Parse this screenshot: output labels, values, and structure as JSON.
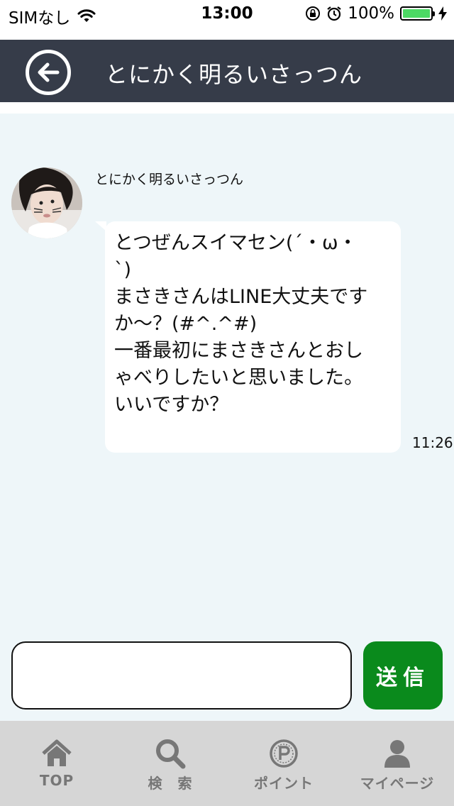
{
  "status_bar": {
    "carrier": "SIMなし",
    "time": "13:00",
    "battery_percent": "100%",
    "battery_level": 1.0,
    "battery_color": "#4cd964"
  },
  "header": {
    "back_icon": "arrow-left-circle-icon",
    "title": "とにかく明るいさっつん",
    "background_color": "#363c49"
  },
  "chat": {
    "background_color": "#eef6f9",
    "messages": [
      {
        "sender": "とにかく明るいさっつん",
        "lines": [
          "とつぜんスイマセン(´・ω・",
          "`)",
          "まさきさんはLINE大丈夫です",
          "か～？(#^.^#)",
          "一番最初にまさきさんとおし",
          "ゃべりしたいと思いました。",
          "いいですか？"
        ],
        "time": "11:26"
      }
    ]
  },
  "composer": {
    "input_value": "",
    "send_label": "送信",
    "send_color": "#0a8a1c"
  },
  "bottom_nav": {
    "items": [
      {
        "label": "TOP",
        "icon": "home-icon"
      },
      {
        "label": "検　索",
        "icon": "search-icon"
      },
      {
        "label": "ポイント",
        "icon": "point-coin-icon"
      },
      {
        "label": "マイページ",
        "icon": "user-icon"
      }
    ],
    "icon_color": "#777777"
  }
}
